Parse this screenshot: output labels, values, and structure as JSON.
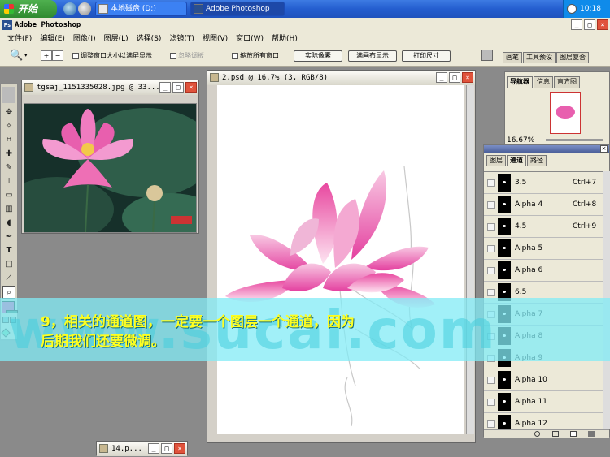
{
  "taskbar": {
    "start_label": "开始",
    "tasks": [
      "本地磁盘 (D:)",
      "Adobe Photoshop"
    ],
    "clock": "10:18"
  },
  "app": {
    "title": "Adobe Photoshop",
    "icon_label": "Ps"
  },
  "window_buttons": {
    "min": "_",
    "max": "□",
    "close": "×"
  },
  "menu": [
    "文件(F)",
    "编辑(E)",
    "图像(I)",
    "图层(L)",
    "选择(S)",
    "滤镜(T)",
    "视图(V)",
    "窗口(W)",
    "帮助(H)"
  ],
  "options": {
    "resize_windows": "调整窗口大小以满屏显示",
    "ignore_palettes": "忽略调板",
    "zoom_all": "缩放所有窗口",
    "actual_pixels": "实际像素",
    "fit_on_screen": "满画布显示",
    "print_size": "打印尺寸"
  },
  "palette_well": {
    "tabs": [
      "画笔",
      "工具预设",
      "图层复合"
    ]
  },
  "documents": {
    "photo": {
      "title": "tgsaj_1151335028.jpg @ 33..."
    },
    "main": {
      "title": "2.psd @ 16.7% (3, RGB/8)"
    },
    "minimized": {
      "title": "14.p..."
    }
  },
  "navigator": {
    "tabs": [
      "导航器",
      "信息",
      "直方图"
    ],
    "zoom": "16.67%"
  },
  "channels": {
    "tabs": [
      "图层",
      "通道",
      "路径"
    ],
    "active_tab": 1,
    "rows": [
      {
        "name": "3.5",
        "shortcut": "Ctrl+7",
        "selected": false
      },
      {
        "name": "Alpha 4",
        "shortcut": "Ctrl+8",
        "selected": false
      },
      {
        "name": "4.5",
        "shortcut": "Ctrl+9",
        "selected": false
      },
      {
        "name": "Alpha 5",
        "shortcut": "",
        "selected": false
      },
      {
        "name": "Alpha 6",
        "shortcut": "",
        "selected": false
      },
      {
        "name": "6.5",
        "shortcut": "",
        "selected": false
      },
      {
        "name": "Alpha 7",
        "shortcut": "",
        "selected": false
      },
      {
        "name": "Alpha 8",
        "shortcut": "",
        "selected": false
      },
      {
        "name": "Alpha 9",
        "shortcut": "",
        "selected": false
      },
      {
        "name": "Alpha 10",
        "shortcut": "",
        "selected": false
      },
      {
        "name": "Alpha 11",
        "shortcut": "",
        "selected": false
      },
      {
        "name": "Alpha 12",
        "shortcut": "",
        "selected": false
      }
    ]
  },
  "caption": {
    "text": "9，相关的通道图，一定要一个图层一个通道，因为\n后期我们还要微调。",
    "watermark": "www.sucai.com"
  },
  "colors": {
    "taskbar_blue": "#245ecf",
    "start_green": "#3a9a3a",
    "foreground_swatch": "#e43fa0",
    "background_swatch": "#2d6e5a",
    "caption_band": "#82ebf5",
    "caption_text": "#ffff20"
  }
}
